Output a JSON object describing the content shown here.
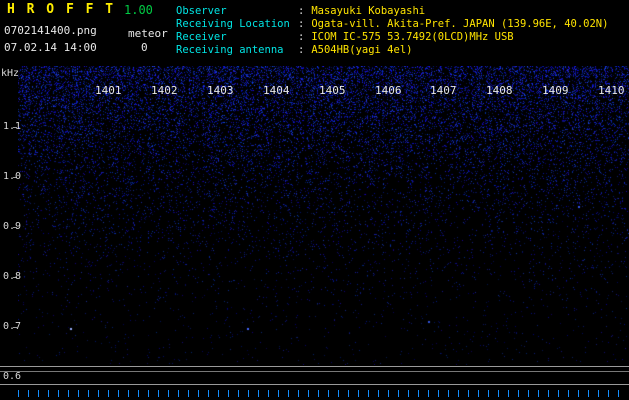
{
  "app": {
    "title": "H R O F F T",
    "version": "1.00",
    "filename": "0702141400.png",
    "mode_label": "meteor",
    "datetime": "07.02.14 14:00",
    "count": "0"
  },
  "info": {
    "rows": [
      {
        "label": "Observer",
        "sep": ":",
        "value": "Masayuki Kobayashi"
      },
      {
        "label": "Receiving Location",
        "sep": ":",
        "value": "Ogata-vill. Akita-Pref. JAPAN (139.96E, 40.02N)"
      },
      {
        "label": "Receiver",
        "sep": ":",
        "value": "ICOM IC-575 53.7492(0LCD)MHz USB"
      },
      {
        "label": "Receiving antenna",
        "sep": ":",
        "value": "A504HB(yagi 4el)"
      }
    ]
  },
  "spectrogram": {
    "unit": "kHz",
    "freq_labels": [
      "1.1",
      "1.0",
      "0.9",
      "0.8",
      "0.7",
      "0.6"
    ],
    "time_labels": [
      "1401",
      "1402",
      "1403",
      "1404",
      "1405",
      "1406",
      "1407",
      "1408",
      "1409",
      "1410"
    ],
    "background": "#000000",
    "noise_color": "#0000dd",
    "tick_color": "#1690ff"
  }
}
